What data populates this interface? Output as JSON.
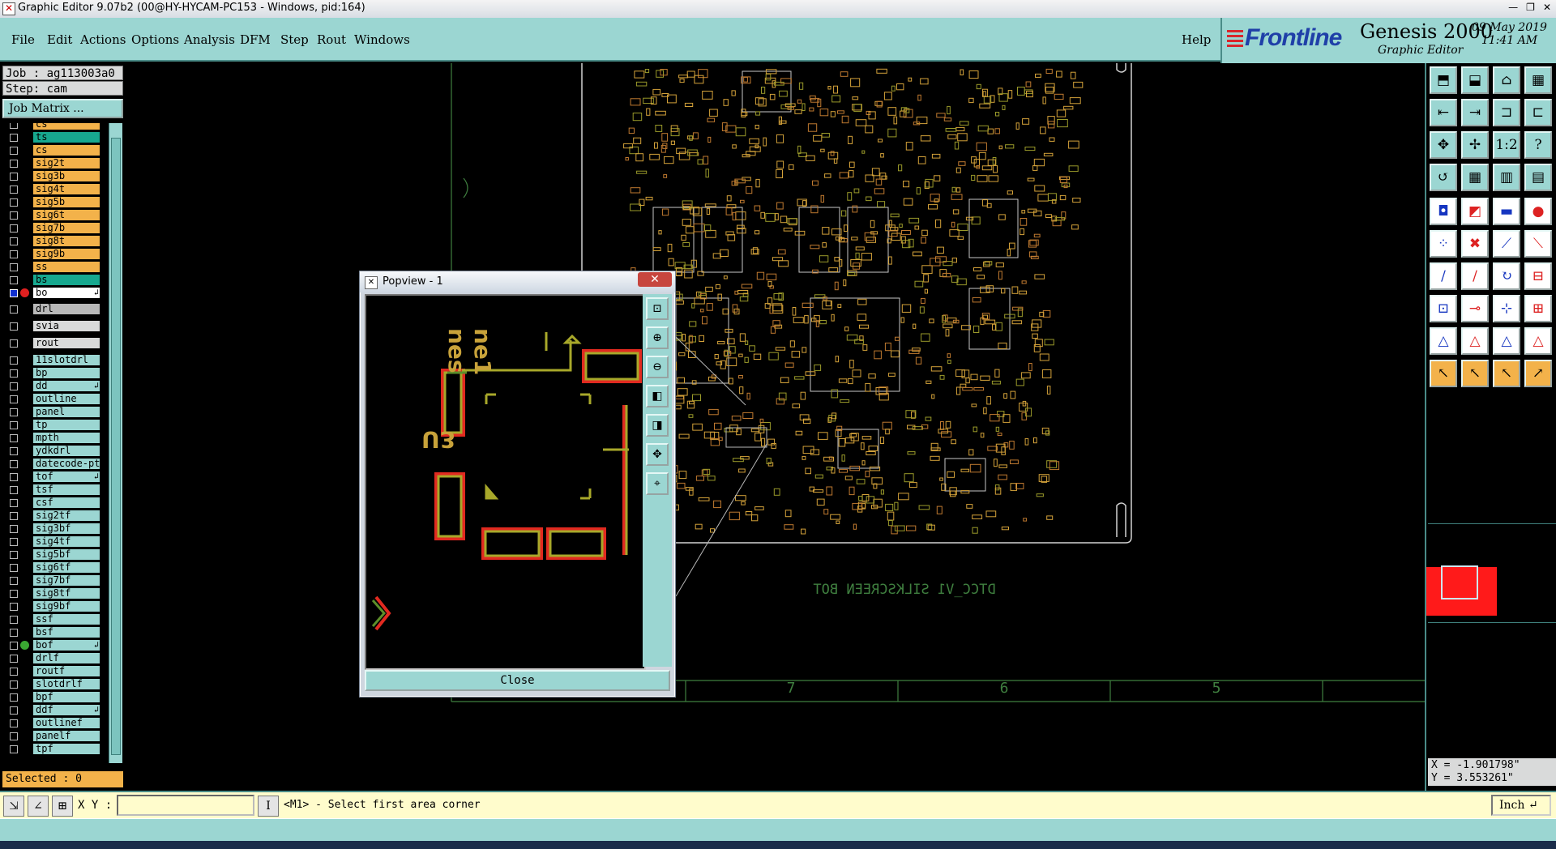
{
  "window": {
    "title": "Graphic Editor 9.07b2 (00@HY-HYCAM-PC153 - Windows, pid:164)",
    "controls": [
      "—",
      "❐",
      "✕"
    ]
  },
  "menu": {
    "items": [
      "File",
      "Edit",
      "Actions",
      "Options",
      "Analysis",
      "DFM",
      "Step",
      "Rout",
      "Windows"
    ],
    "help": "Help"
  },
  "brand": {
    "logo": "Frontline",
    "product": "Genesis 2000",
    "subtitle": "Graphic Editor",
    "date": "09 May 2019",
    "time": "11:41 AM"
  },
  "job": {
    "job_line": "Job : ag113003a0",
    "step_line": "Step: cam",
    "matrix_button": "Job Matrix ..."
  },
  "layers": [
    {
      "name": "cs",
      "color": "#f3b24a"
    },
    {
      "name": "ts",
      "color": "#17a88f"
    },
    {
      "name": "cs",
      "color": "#f3b24a"
    },
    {
      "name": "sig2t",
      "color": "#f3b24a"
    },
    {
      "name": "sig3b",
      "color": "#f3b24a"
    },
    {
      "name": "sig4t",
      "color": "#f3b24a"
    },
    {
      "name": "sig5b",
      "color": "#f3b24a"
    },
    {
      "name": "sig6t",
      "color": "#f3b24a"
    },
    {
      "name": "sig7b",
      "color": "#f3b24a"
    },
    {
      "name": "sig8t",
      "color": "#f3b24a"
    },
    {
      "name": "sig9b",
      "color": "#f3b24a"
    },
    {
      "name": "ss",
      "color": "#f3b24a"
    },
    {
      "name": "bs",
      "color": "#17a88f"
    },
    {
      "name": "bo",
      "color": "#ffffff",
      "dot": "#e02020",
      "mark": "↲",
      "active": true
    },
    {
      "name": "drl",
      "color": "#b8b8b8"
    },
    {
      "name": "svia",
      "color": "#d9dada"
    },
    {
      "name": "rout",
      "color": "#d9dada"
    },
    {
      "name": "11slotdrl",
      "color": "#9bd6d2"
    },
    {
      "name": "bp",
      "color": "#9bd6d2"
    },
    {
      "name": "dd",
      "color": "#9bd6d2",
      "mark": "↲"
    },
    {
      "name": "outline",
      "color": "#9bd6d2"
    },
    {
      "name": "panel",
      "color": "#9bd6d2"
    },
    {
      "name": "tp",
      "color": "#9bd6d2"
    },
    {
      "name": "mpth",
      "color": "#9bd6d2"
    },
    {
      "name": "ydkdrl",
      "color": "#9bd6d2"
    },
    {
      "name": "datecode-pt",
      "color": "#9bd6d2"
    },
    {
      "name": "tof",
      "color": "#9bd6d2",
      "mark": "↲"
    },
    {
      "name": "tsf",
      "color": "#9bd6d2"
    },
    {
      "name": "csf",
      "color": "#9bd6d2"
    },
    {
      "name": "sig2tf",
      "color": "#9bd6d2"
    },
    {
      "name": "sig3bf",
      "color": "#9bd6d2"
    },
    {
      "name": "sig4tf",
      "color": "#9bd6d2"
    },
    {
      "name": "sig5bf",
      "color": "#9bd6d2"
    },
    {
      "name": "sig6tf",
      "color": "#9bd6d2"
    },
    {
      "name": "sig7bf",
      "color": "#9bd6d2"
    },
    {
      "name": "sig8tf",
      "color": "#9bd6d2"
    },
    {
      "name": "sig9bf",
      "color": "#9bd6d2"
    },
    {
      "name": "ssf",
      "color": "#9bd6d2"
    },
    {
      "name": "bsf",
      "color": "#9bd6d2"
    },
    {
      "name": "bof",
      "color": "#9bd6d2",
      "dot": "#3aa832",
      "mark": "↲"
    },
    {
      "name": "drlf",
      "color": "#9bd6d2"
    },
    {
      "name": "routf",
      "color": "#9bd6d2"
    },
    {
      "name": "slotdrlf",
      "color": "#9bd6d2"
    },
    {
      "name": "bpf",
      "color": "#9bd6d2"
    },
    {
      "name": "ddf",
      "color": "#9bd6d2",
      "mark": "↲"
    },
    {
      "name": "outlinef",
      "color": "#9bd6d2"
    },
    {
      "name": "panelf",
      "color": "#9bd6d2"
    },
    {
      "name": "tpf",
      "color": "#9bd6d2"
    }
  ],
  "selected": "Selected : 0",
  "canvas": {
    "board_text": "DTCC_V1 SILKSCREEN BOT",
    "ruler_marks": [
      "7",
      "6",
      "5"
    ]
  },
  "popview": {
    "title": "Popview - 1",
    "close_label": "Close",
    "component_labels": [
      "U3",
      "nes",
      "ne1"
    ]
  },
  "toolbar": {
    "icons": [
      "open-icon",
      "save-icon",
      "home-icon",
      "window-icon",
      "zoom-in-icon",
      "zoom-out-icon",
      "home-view-icon",
      "redraw-icon",
      "fit-icon",
      "pan-icon",
      "scale-icon",
      "help-icon",
      "snap-icon",
      "grid-icon",
      "layer-up-icon",
      "layer-down-icon",
      "pad-icon",
      "line-icon",
      "measure-icon",
      "hole-icon",
      "node-icon",
      "cross-icon",
      "connect-icon",
      "disconnect-icon",
      "edit-line-icon",
      "slash-icon",
      "arc-icon",
      "align-icon",
      "copy-icon",
      "move-icon",
      "resize-icon",
      "group-icon",
      "poly-icon",
      "poly2-icon",
      "poly3-icon",
      "poly4-icon",
      "select-icon",
      "select2-icon",
      "select3-icon",
      "select4-icon"
    ],
    "coord_x": "X = -1.901798\"",
    "coord_y": "Y = 3.553261\""
  },
  "command": {
    "xy_label": "X Y :",
    "xy_value": "",
    "prompt": "<M1> - Select first area corner",
    "units": "Inch"
  }
}
